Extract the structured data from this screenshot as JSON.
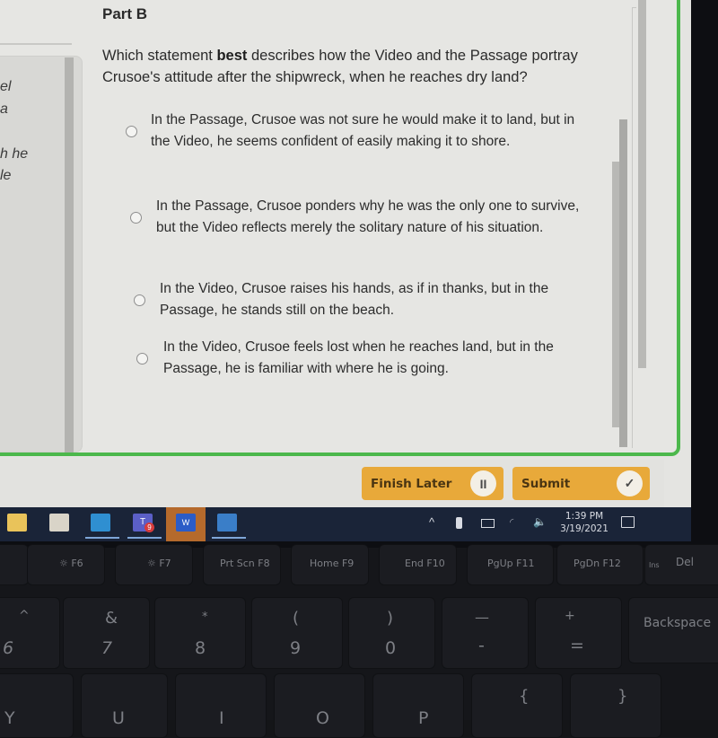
{
  "left_panel": {
    "text_fragments": [
      "el",
      "a",
      "h he",
      "le"
    ]
  },
  "question": {
    "part_title": "Part B",
    "prompt_before": "Which statement ",
    "prompt_bold": "best",
    "prompt_after": " describes how the Video and the Passage portray Crusoe's attitude after the shipwreck, when he reaches dry land?",
    "options": [
      {
        "text": "In the Passage, Crusoe was not sure he would make it to land, but in the Video, he seems confident of easily making it to shore.",
        "selected": false
      },
      {
        "text": "In the Passage, Crusoe ponders why he was the only one to survive, but the Video reflects merely the solitary nature of his situation.",
        "selected": false
      },
      {
        "text": "In the Video, Crusoe raises his hands, as if in thanks, but in the Passage, he stands still on the beach.",
        "selected": false
      },
      {
        "text": "In the Video, Crusoe feels lost when he reaches land, but in the Passage, he is familiar with where he is going.",
        "selected": false
      }
    ]
  },
  "actions": {
    "finish_later_label": "Finish Later",
    "finish_later_icon": "II",
    "submit_label": "Submit",
    "submit_icon": "✓"
  },
  "taskbar": {
    "apps": [
      "file-explorer",
      "microsoft-store",
      "mail",
      "teams",
      "word",
      "photos"
    ],
    "active_app": "word",
    "teams_badge": "9",
    "word_letter": "W",
    "teams_letter": "T",
    "time": "1:39 PM",
    "date": "3/19/2021"
  },
  "keyboard": {
    "fn_row": [
      "☼ F6",
      "☼ F7",
      "Prt Scn F8",
      "Home F9",
      "End F10",
      "PgUp F11",
      "PgDn F12",
      "Ins",
      "Del"
    ],
    "number_row": [
      {
        "top": "^",
        "bottom": "6"
      },
      {
        "top": "&",
        "bottom": "7"
      },
      {
        "top": "*",
        "bottom": "8"
      },
      {
        "top": "(",
        "bottom": "9"
      },
      {
        "top": ")",
        "bottom": "0"
      },
      {
        "top": "—",
        "bottom": "-"
      },
      {
        "top": "+",
        "bottom": "="
      }
    ],
    "backspace": "Backspace",
    "brace_open": "{",
    "brace_close": "}",
    "letter_y": "Y",
    "letter_u": "U",
    "letter_i": "I",
    "letter_o": "O",
    "letter_p": "P"
  },
  "colors": {
    "accent_green": "#4cb84c",
    "button_orange": "#e8a93a",
    "taskbar_bg": "#1a2438"
  }
}
